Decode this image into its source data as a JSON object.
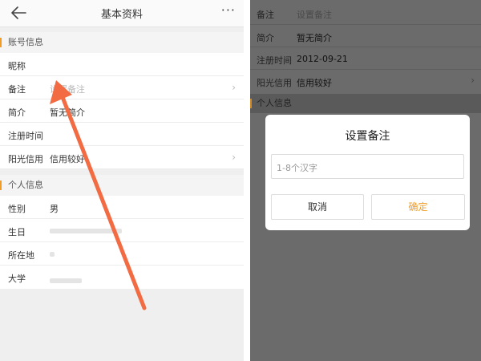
{
  "header": {
    "title": "基本资料",
    "more": "···"
  },
  "account_section": {
    "title": "账号信息",
    "rows": [
      {
        "label": "昵称",
        "value": ""
      },
      {
        "label": "备注",
        "value": "设置备注"
      },
      {
        "label": "简介",
        "value": "暂无简介"
      },
      {
        "label": "注册时间",
        "value": ""
      },
      {
        "label": "阳光信用",
        "value": "信用较好"
      }
    ]
  },
  "personal_section": {
    "title": "个人信息",
    "rows": [
      {
        "label": "性别",
        "value": "男"
      },
      {
        "label": "生日",
        "value": ""
      },
      {
        "label": "所在地",
        "value": ""
      },
      {
        "label": "大学",
        "value": ""
      }
    ]
  },
  "right_rows": [
    {
      "label": "备注",
      "value": "设置备注"
    },
    {
      "label": "简介",
      "value": "暂无简介"
    },
    {
      "label": "注册时间",
      "value": "2012-09-21"
    },
    {
      "label": "阳光信用",
      "value": "信用较好"
    }
  ],
  "right_section": {
    "title": "个人信息"
  },
  "dialog": {
    "title": "设置备注",
    "placeholder": "1-8个汉字",
    "cancel": "取消",
    "confirm": "确定"
  },
  "colors": {
    "accent": "#f29c25",
    "arrow": "#f26b43",
    "overlay": "#6b6b6b"
  }
}
